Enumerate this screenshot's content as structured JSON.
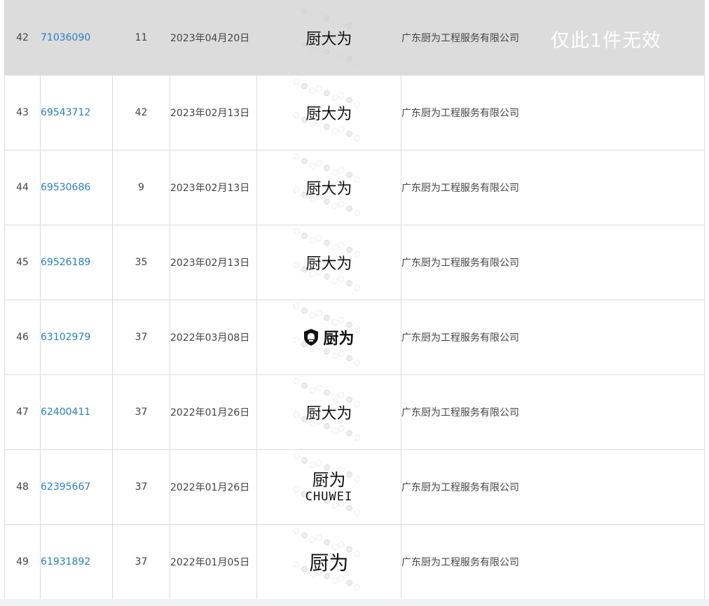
{
  "rows": [
    {
      "index": "42",
      "reg_no": "71036090",
      "class": "11",
      "date": "2023年04月20日",
      "mark": {
        "type": "text",
        "text": "厨大为"
      },
      "owner": "广东厨为工程服务有限公司",
      "note": "仅此1件无效"
    },
    {
      "index": "43",
      "reg_no": "69543712",
      "class": "42",
      "date": "2023年02月13日",
      "mark": {
        "type": "text",
        "text": "厨大为"
      },
      "owner": "广东厨为工程服务有限公司"
    },
    {
      "index": "44",
      "reg_no": "69530686",
      "class": "9",
      "date": "2023年02月13日",
      "mark": {
        "type": "text",
        "text": "厨大为"
      },
      "owner": "广东厨为工程服务有限公司"
    },
    {
      "index": "45",
      "reg_no": "69526189",
      "class": "35",
      "date": "2023年02月13日",
      "mark": {
        "type": "text",
        "text": "厨大为"
      },
      "owner": "广东厨为工程服务有限公司"
    },
    {
      "index": "46",
      "reg_no": "63102979",
      "class": "37",
      "date": "2022年03月08日",
      "mark": {
        "type": "logo",
        "text": "厨为"
      },
      "owner": "广东厨为工程服务有限公司"
    },
    {
      "index": "47",
      "reg_no": "62400411",
      "class": "37",
      "date": "2022年01月26日",
      "mark": {
        "type": "text",
        "text": "厨大为"
      },
      "owner": "广东厨为工程服务有限公司"
    },
    {
      "index": "48",
      "reg_no": "62395667",
      "class": "37",
      "date": "2022年01月26日",
      "mark": {
        "type": "stack",
        "text": "厨为",
        "sub": "CHUWEI"
      },
      "owner": "广东厨为工程服务有限公司"
    },
    {
      "index": "49",
      "reg_no": "61931892",
      "class": "37",
      "date": "2022年01月05日",
      "mark": {
        "type": "big",
        "text": "厨为"
      },
      "owner": "广东厨为工程服务有限公司"
    }
  ],
  "colors": {
    "link": "#2a7fc1",
    "invalid_row_bg": "#dcdcdc",
    "border": "#dcdcdc"
  }
}
